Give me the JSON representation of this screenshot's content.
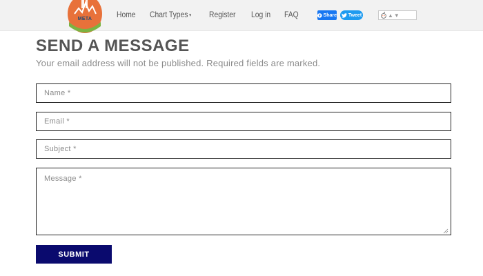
{
  "header": {
    "logo_text": "META",
    "logo_icon": "meta-chart-logo",
    "nav": {
      "home": "Home",
      "chart_types": "Chart Types",
      "register": "Register",
      "login": "Log in",
      "faq": "FAQ"
    },
    "share_label": "Share",
    "tweet_label": "Tweet",
    "reddit_icon": "reddit-icon"
  },
  "form": {
    "title": "SEND A MESSAGE",
    "subtitle": "Your email address will not be published. Required fields are marked.",
    "name_placeholder": "Name *",
    "email_placeholder": "Email *",
    "subject_placeholder": "Subject *",
    "message_placeholder": "Message *",
    "submit_label": "SUBMIT"
  },
  "colors": {
    "submit_bg": "#0a0a6e",
    "share_bg": "#1877f2",
    "tweet_bg": "#1d9bf0"
  }
}
